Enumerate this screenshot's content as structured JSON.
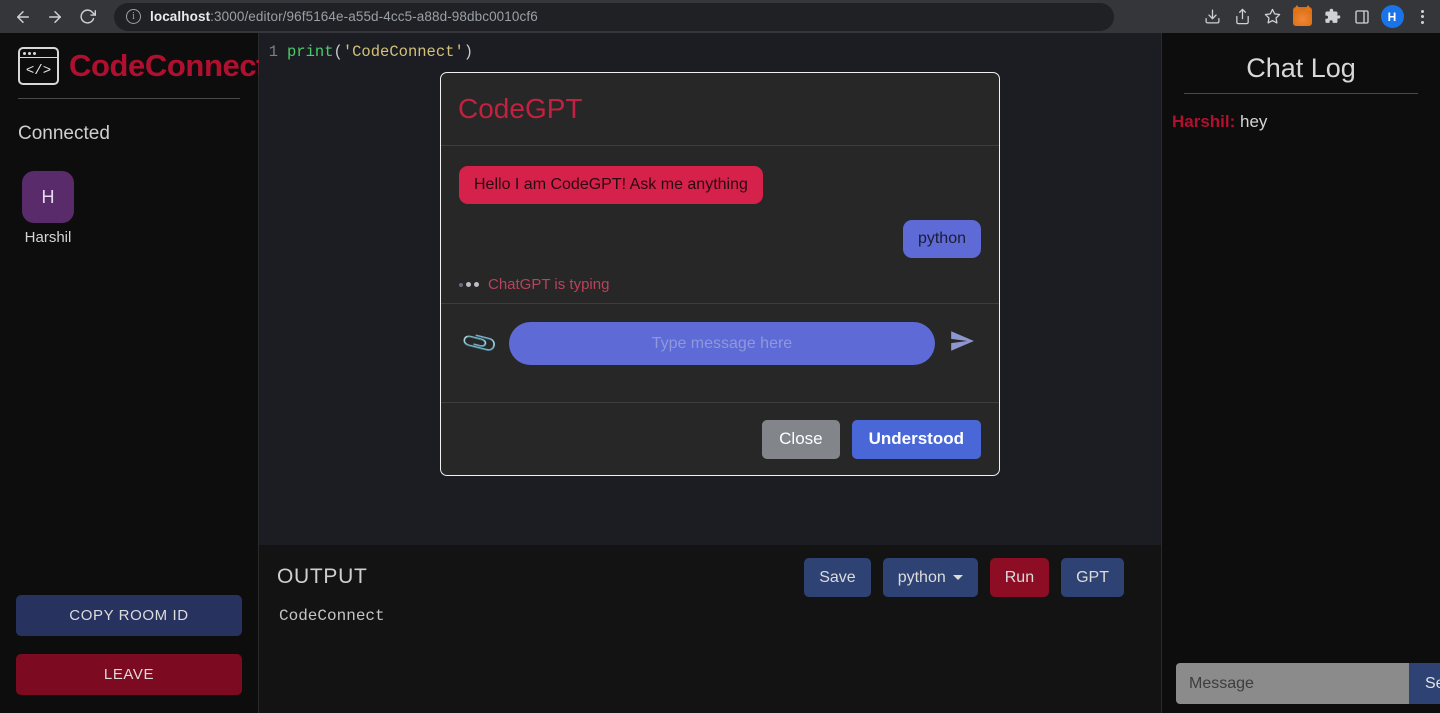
{
  "browser": {
    "back_icon": "back-arrow-icon",
    "forward_icon": "forward-arrow-icon",
    "reload_icon": "reload-icon",
    "info_glyph": "i",
    "url_host": "localhost",
    "url_rest": ":3000/editor/96f5164e-a55d-4cc5-a88d-98dbc0010cf6",
    "toolbar_icons": [
      "download-icon",
      "share-icon",
      "bookmark-star-icon",
      "metamask-fox-icon",
      "extensions-puzzle-icon",
      "side-panel-icon",
      "profile-avatar",
      "menu-kebab-icon"
    ],
    "profile_initial": "H"
  },
  "sidebar": {
    "brand": "CodeConnect",
    "logo_code": "</>",
    "connected_label": "Connected",
    "clients": [
      {
        "initial": "H",
        "name": "Harshil"
      }
    ],
    "copy_room_label": "COPY ROOM ID",
    "leave_label": "LEAVE"
  },
  "editor": {
    "line_number": "1",
    "code": {
      "fn": "print",
      "open": "(",
      "string": "'CodeConnect'",
      "close": ")"
    }
  },
  "output": {
    "title": "OUTPUT",
    "body": "CodeConnect",
    "buttons": {
      "save": "Save",
      "language": "python",
      "run": "Run",
      "gpt": "GPT"
    }
  },
  "chat_panel": {
    "title": "Chat Log",
    "messages": [
      {
        "who": "Harshil:",
        "text": " hey"
      }
    ],
    "input_placeholder": "Message",
    "input_value": "",
    "send_label": "Send"
  },
  "modal": {
    "title": "CodeGPT",
    "messages": [
      {
        "role": "bot",
        "text": "Hello I am CodeGPT! Ask me anything"
      },
      {
        "role": "user",
        "text": "python"
      }
    ],
    "typing_text": "ChatGPT is typing",
    "attach_icon": "paperclip-icon",
    "send_icon": "send-plane-icon",
    "compose_placeholder": "Type message here",
    "compose_value": "",
    "close_label": "Close",
    "confirm_label": "Understood"
  },
  "colors": {
    "brand_red": "#b01030",
    "bot_bubble": "#d6214a",
    "user_bubble": "#5e6ad6",
    "accent_blue": "#2e4374",
    "danger_red": "#8c0d24",
    "avatar_purple": "#5a2b6b"
  }
}
